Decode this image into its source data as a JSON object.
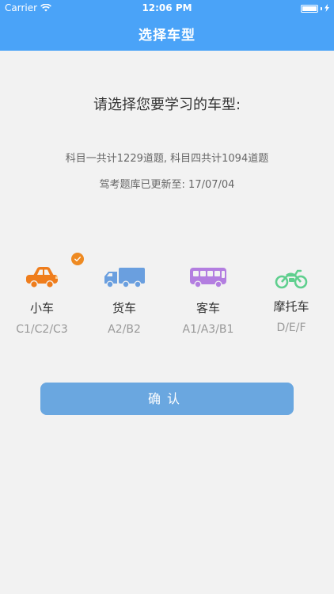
{
  "status_bar": {
    "carrier": "Carrier",
    "time": "12:06 PM"
  },
  "nav": {
    "title": "选择车型"
  },
  "prompt": "请选择您要学习的车型:",
  "info": {
    "line1": "科目一共计1229道题, 科目四共计1094道题",
    "line2": "驾考题库已更新至: 17/07/04"
  },
  "vehicles": [
    {
      "name": "小车",
      "code": "C1/C2/C3",
      "icon": "car-icon",
      "color": "#ef7d1c",
      "selected": true
    },
    {
      "name": "货车",
      "code": "A2/B2",
      "icon": "truck-icon",
      "color": "#6a9fdf",
      "selected": false
    },
    {
      "name": "客车",
      "code": "A1/A3/B1",
      "icon": "bus-icon",
      "color": "#b37ee0",
      "selected": false
    },
    {
      "name": "摩托车",
      "code": "D/E/F",
      "icon": "motorcycle-icon",
      "color": "#5fcf8e",
      "selected": false
    }
  ],
  "confirm_label": "确认",
  "colors": {
    "header": "#4aa3f8",
    "button": "#6aa7e0",
    "selected_badge": "#ee8a22",
    "background": "#f2f2f2"
  }
}
